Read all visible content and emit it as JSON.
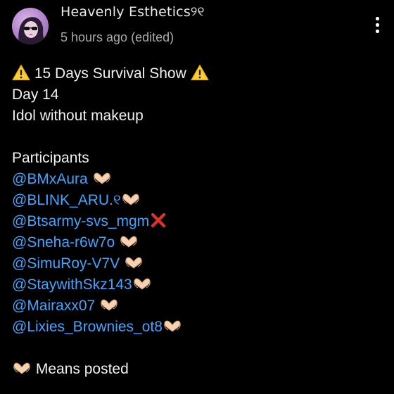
{
  "post": {
    "author": "Heavenly Esthetics୨୧",
    "timestamp": "5 hours ago",
    "edited_label": "(edited)",
    "title": "15 Days Survival Show",
    "day": "Day 14",
    "theme": "Idol without makeup",
    "participants_heading": "Participants",
    "participants": [
      {
        "handle": "@BMxAura",
        "status_icon": "heart-hands-icon"
      },
      {
        "handle": "@BLINK_ARU.୧",
        "status_icon": "heart-hands-icon"
      },
      {
        "handle": "@Btsarmy-svs_mgm",
        "status_icon": "cross-mark-icon"
      },
      {
        "handle": "@Sneha-r6w7o",
        "status_icon": "heart-hands-icon"
      },
      {
        "handle": "@SimuRoy-V7V",
        "status_icon": "heart-hands-icon"
      },
      {
        "handle": "@StaywithSkz143",
        "status_icon": "heart-hands-icon"
      },
      {
        "handle": "@Mairaxx07",
        "status_icon": "heart-hands-icon"
      },
      {
        "handle": "@Lixies_Brownies_ot8",
        "status_icon": "heart-hands-icon"
      }
    ],
    "legend": "Means posted"
  },
  "icons": {
    "title_left": "warning-icon",
    "title_right": "warning-icon",
    "legend_icon": "heart-hands-icon",
    "menu": "more-vert-icon"
  },
  "colors": {
    "background": "#000000",
    "mention": "#3ea6ff",
    "text": "#f1f1f1",
    "meta": "#aaaaaa"
  }
}
